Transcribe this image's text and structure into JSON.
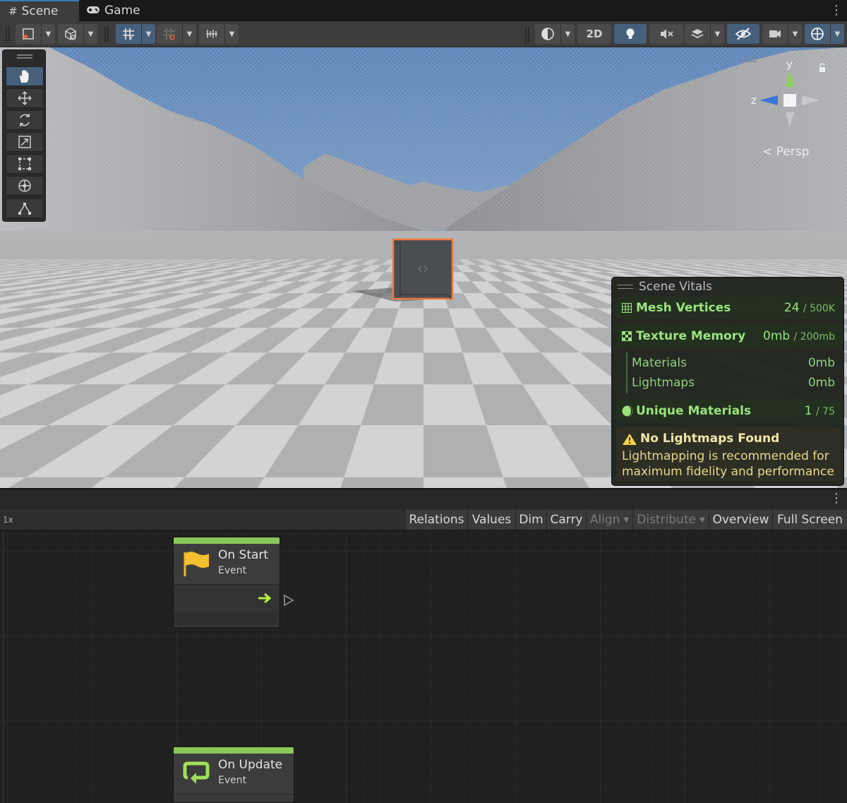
{
  "tabs": [
    {
      "label": "Scene",
      "icon": "hash-icon",
      "active": true
    },
    {
      "label": "Game",
      "icon": "gamepad-icon",
      "active": false
    }
  ],
  "toolbar": {
    "toggle_2d": "2D"
  },
  "gizmo": {
    "y_label": "y",
    "z_label": "z",
    "projection": "Persp"
  },
  "vitals": {
    "title": "Scene Vitals",
    "mesh_vertices": {
      "label": "Mesh Vertices",
      "value": "24",
      "limit": "/ 500K"
    },
    "texture_memory": {
      "label": "Texture Memory",
      "value": "0mb",
      "limit": "/ 200mb"
    },
    "materials": {
      "label": "Materials",
      "value": "0mb"
    },
    "lightmaps": {
      "label": "Lightmaps",
      "value": "0mb"
    },
    "unique_materials": {
      "label": "Unique Materials",
      "value": "1",
      "limit": "/ 75"
    },
    "warning": {
      "title": "No Lightmaps Found",
      "text": "Lightmapping is recommended for maximum fidelity and performance"
    },
    "colors": {
      "accent": "#9be37e",
      "warning": "#f1e7a8"
    }
  },
  "graph_toolbar": {
    "zoom": "1x",
    "buttons": [
      "Relations",
      "Values",
      "Dim",
      "Carry",
      "Align",
      "Distribute",
      "Overview",
      "Full Screen"
    ]
  },
  "nodes": [
    {
      "title": "On Start",
      "subtitle": "Event",
      "icon": "flag-icon"
    },
    {
      "title": "On Update",
      "subtitle": "Event",
      "icon": "loop-icon"
    }
  ]
}
